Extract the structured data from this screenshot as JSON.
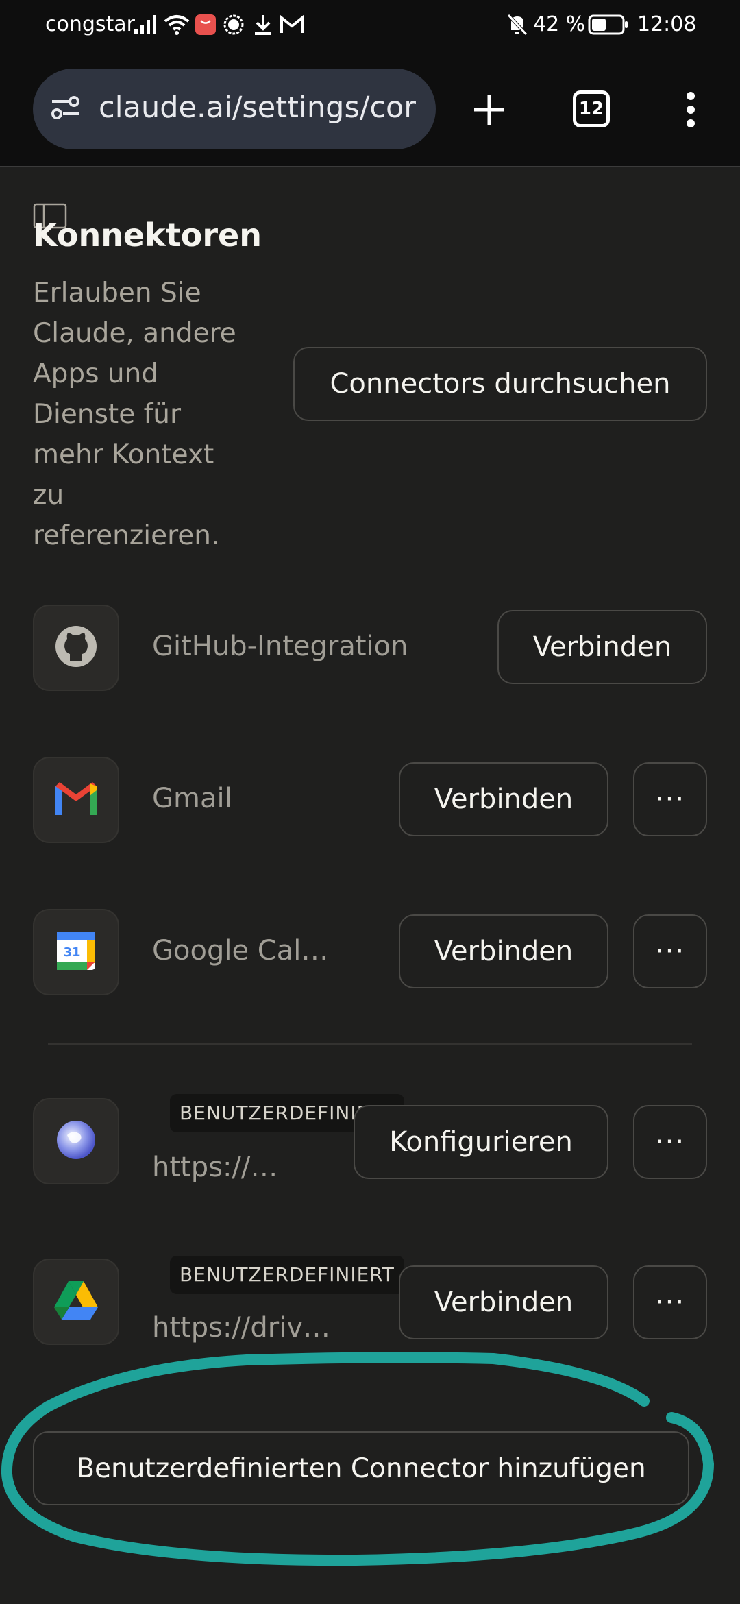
{
  "status_bar": {
    "carrier": "congstar",
    "battery_text": "42 %",
    "time": "12:08"
  },
  "browser": {
    "url": "claude.ai/settings/cor",
    "tab_count": "12"
  },
  "section": {
    "title": "Konnektoren",
    "description": "Erlauben Sie Claude, andere Apps und Dienste für mehr Kontext zu referenzieren.",
    "browse_label": "Connectors durchsuchen"
  },
  "connectors": [
    {
      "name": "GitHub-Integration",
      "action": "Verbinden",
      "icon": "github-icon"
    },
    {
      "name": "Gmail",
      "action": "Verbinden",
      "icon": "gmail-icon",
      "more": "···"
    },
    {
      "name": "Google Cal…",
      "action": "Verbinden",
      "icon": "google-calendar-icon",
      "more": "···"
    }
  ],
  "custom_connectors": [
    {
      "badge": "BENUTZERDEFINIERT",
      "url": "https://…",
      "action": "Konfigurieren",
      "icon": "globe-icon",
      "more": "···"
    },
    {
      "badge": "BENUTZERDEFINIERT",
      "url": "https://driv…",
      "action": "Verbinden",
      "icon": "google-drive-icon",
      "more": "···"
    }
  ],
  "add_custom_label": "Benutzerdefinierten Connector hinzufügen",
  "colors": {
    "background": "#1f1f1e",
    "annotation": "#1fa39a",
    "url_pill": "#2f3440"
  }
}
